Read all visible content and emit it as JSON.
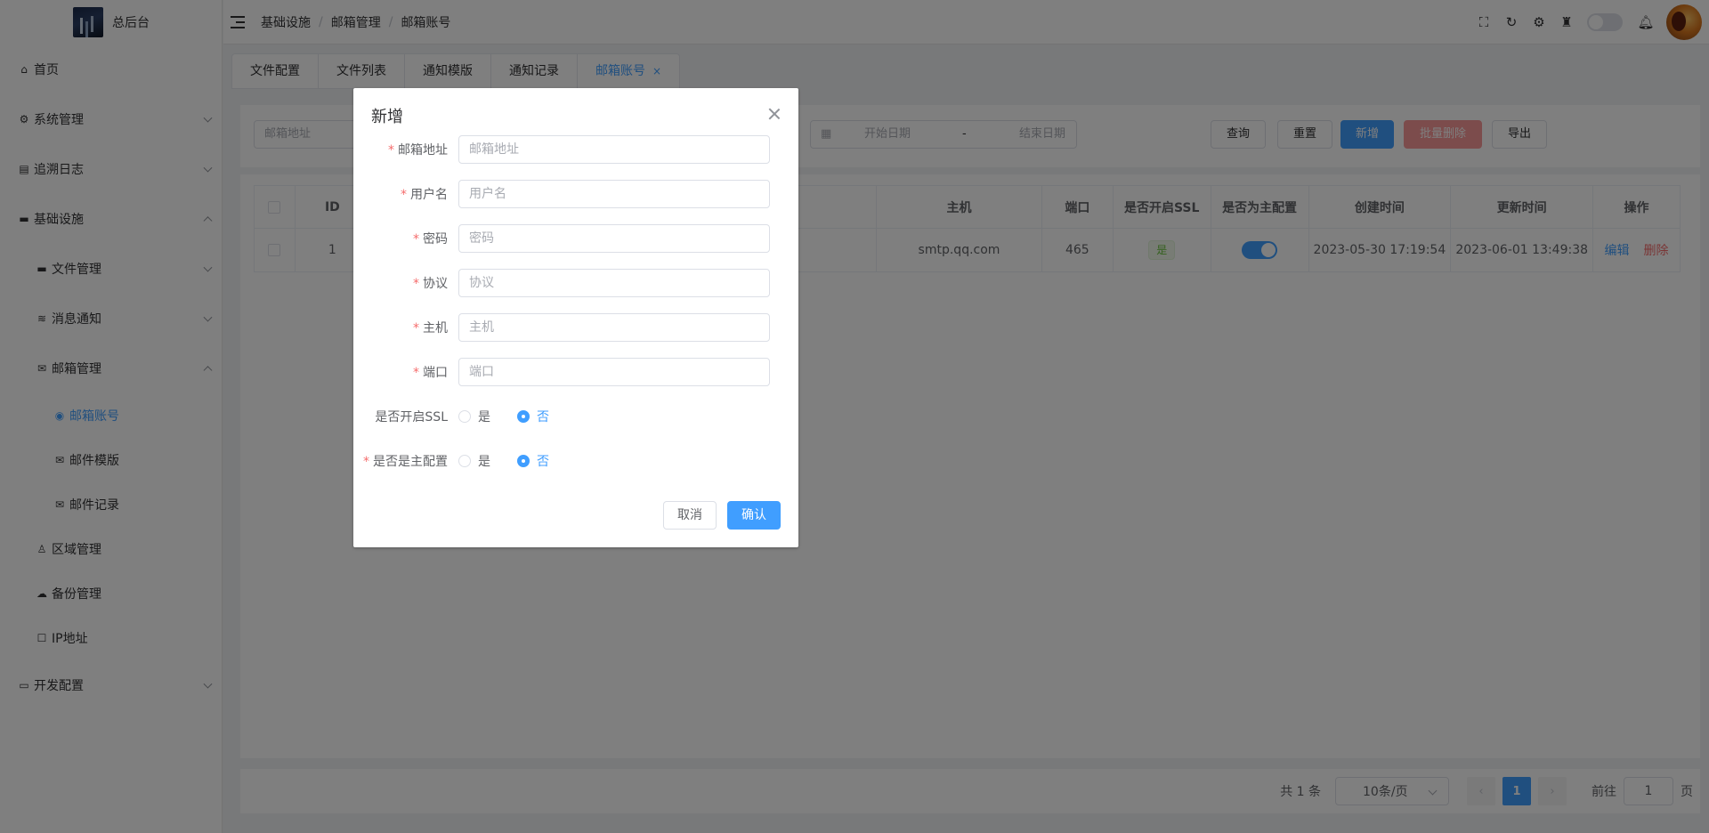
{
  "sidebar": {
    "logo_text": "总后台",
    "items": [
      {
        "label": "首页"
      },
      {
        "label": "系统管理"
      },
      {
        "label": "追溯日志"
      },
      {
        "label": "基础设施"
      },
      {
        "label": "文件管理"
      },
      {
        "label": "消息通知"
      },
      {
        "label": "邮箱管理"
      },
      {
        "label": "邮箱账号"
      },
      {
        "label": "邮件模版"
      },
      {
        "label": "邮件记录"
      },
      {
        "label": "区域管理"
      },
      {
        "label": "备份管理"
      },
      {
        "label": "IP地址"
      },
      {
        "label": "开发配置"
      }
    ]
  },
  "header": {
    "breadcrumb": [
      "基础设施",
      "邮箱管理",
      "邮箱账号"
    ],
    "breadcrumb_sep": "/"
  },
  "tabs": [
    {
      "label": "文件配置"
    },
    {
      "label": "文件列表"
    },
    {
      "label": "通知模版"
    },
    {
      "label": "通知记录"
    },
    {
      "label": "邮箱账号",
      "close": "×"
    }
  ],
  "search": {
    "email_placeholder": "邮箱地址",
    "start_date_placeholder": "开始日期",
    "date_sep": "-",
    "end_date_placeholder": "结束日期",
    "query": "查询",
    "reset": "重置",
    "add": "新增",
    "batch_delete": "批量删除",
    "export": "导出"
  },
  "table": {
    "headers": {
      "id": "ID",
      "host": "主机",
      "port": "端口",
      "ssl": "是否开启SSL",
      "primary": "是否为主配置",
      "created": "创建时间",
      "updated": "更新时间",
      "actions": "操作"
    },
    "rows": [
      {
        "id": "1",
        "host": "smtp.qq.com",
        "port": "465",
        "ssl": "是",
        "primary_on": true,
        "created": "2023-05-30 17:19:54",
        "updated": "2023-06-01 13:49:38",
        "edit": "编辑",
        "delete": "删除"
      }
    ]
  },
  "pagination": {
    "total": "共 1 条",
    "page_size": "10条/页",
    "prev": "‹",
    "current": "1",
    "next": "›",
    "goto_label": "前往",
    "goto_value": "1",
    "goto_suffix": "页"
  },
  "dialog": {
    "title": "新增",
    "required_mark": "*",
    "fields": [
      {
        "label": "邮箱地址",
        "placeholder": "邮箱地址",
        "required": true
      },
      {
        "label": "用户名",
        "placeholder": "用户名",
        "required": true
      },
      {
        "label": "密码",
        "placeholder": "密码",
        "required": true
      },
      {
        "label": "协议",
        "placeholder": "协议",
        "required": true
      },
      {
        "label": "主机",
        "placeholder": "主机",
        "required": true
      },
      {
        "label": "端口",
        "placeholder": "端口",
        "required": true
      }
    ],
    "ssl": {
      "label": "是否开启SSL",
      "yes": "是",
      "no": "否",
      "selected": "no"
    },
    "primary": {
      "label": "是否是主配置",
      "yes": "是",
      "no": "否",
      "selected": "no"
    },
    "cancel": "取消",
    "confirm": "确认"
  },
  "colors": {
    "primary": "#409eff",
    "danger": "#f56c6c",
    "success": "#67c23a"
  }
}
